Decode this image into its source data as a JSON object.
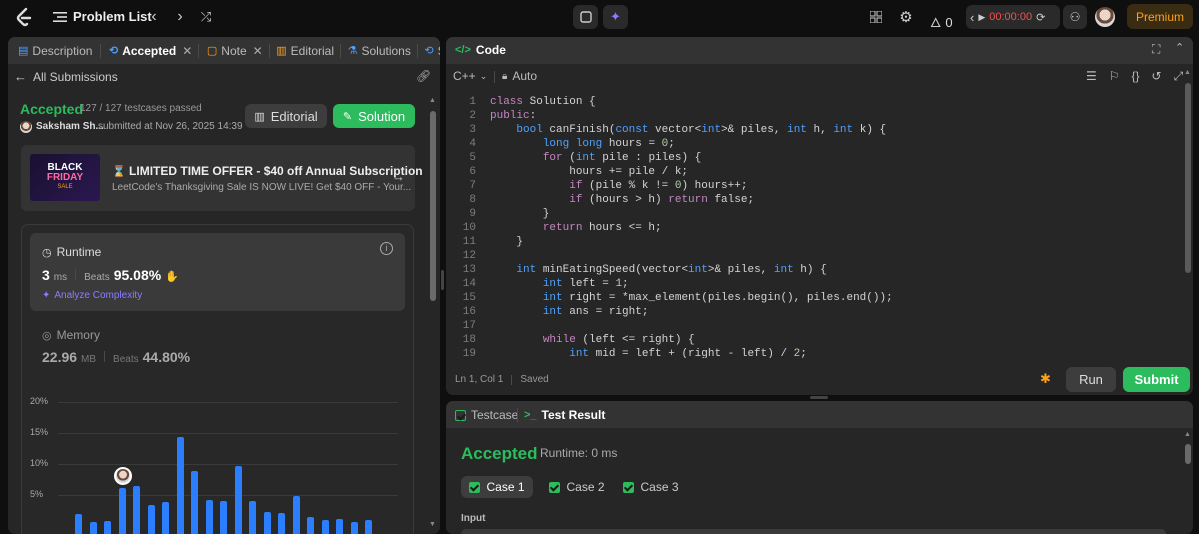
{
  "topbar": {
    "problem_list": "Problem List",
    "streak": "0",
    "timer": "00:00:00",
    "premium": "Premium"
  },
  "left_tabs": [
    "Description",
    "Accepted",
    "Note",
    "Editorial",
    "Solutions",
    "Su"
  ],
  "submission": {
    "back_label": "All Submissions",
    "status": "Accepted",
    "testcases": "127 / 127 testcases passed",
    "user": "Saksham Sh...",
    "submitted": "submitted at Nov 26, 2025 14:39",
    "editorial_btn": "Editorial",
    "solution_btn": "Solution"
  },
  "promo": {
    "banner_line1": "BLACK",
    "banner_line2": "FRIDAY",
    "banner_line3": "SALE",
    "title": "LIMITED TIME OFFER - $40 off Annual Subscription",
    "subtitle": "LeetCode's Thanksgiving Sale IS NOW LIVE! Get $40 OFF - Your..."
  },
  "runtime": {
    "label": "Runtime",
    "value": "3",
    "unit": "ms",
    "beats_label": "Beats",
    "beats_value": "95.08%",
    "analyze": "Analyze Complexity"
  },
  "memory": {
    "label": "Memory",
    "value": "22.96",
    "unit": "MB",
    "beats_label": "Beats",
    "beats_value": "44.80%"
  },
  "chart_data": {
    "type": "bar",
    "y_ticks": [
      "20%",
      "15%",
      "10%",
      "5%"
    ],
    "ylim": [
      0,
      20
    ],
    "values": [
      2.0,
      0.6,
      0.8,
      6.2,
      6.5,
      3.4,
      3.9,
      14.3,
      8.8,
      4.2,
      4.0,
      9.6,
      4.1,
      2.2,
      2.1,
      4.9,
      1.4,
      0.9,
      1.2,
      0.7,
      1.0
    ],
    "highlight_index": 3
  },
  "editor": {
    "title": "Code",
    "language": "C++",
    "auto_label": "Auto",
    "status_pos": "Ln 1, Col 1",
    "status_saved": "Saved",
    "run_btn": "Run",
    "submit_btn": "Submit"
  },
  "code_lines": [
    {
      "n": "1",
      "t": "class Solution {"
    },
    {
      "n": "2",
      "t": "public:"
    },
    {
      "n": "3",
      "t": "    bool canFinish(const vector<int>& piles, int h, int k) {"
    },
    {
      "n": "4",
      "t": "        long long hours = 0;"
    },
    {
      "n": "5",
      "t": "        for (int pile : piles) {"
    },
    {
      "n": "6",
      "t": "            hours += pile / k;"
    },
    {
      "n": "7",
      "t": "            if (pile % k != 0) hours++;"
    },
    {
      "n": "8",
      "t": "            if (hours > h) return false;"
    },
    {
      "n": "9",
      "t": "        }"
    },
    {
      "n": "10",
      "t": "        return hours <= h;"
    },
    {
      "n": "11",
      "t": "    }"
    },
    {
      "n": "12",
      "t": ""
    },
    {
      "n": "13",
      "t": "    int minEatingSpeed(vector<int>& piles, int h) {"
    },
    {
      "n": "14",
      "t": "        int left = 1;"
    },
    {
      "n": "15",
      "t": "        int right = *max_element(piles.begin(), piles.end());"
    },
    {
      "n": "16",
      "t": "        int ans = right;"
    },
    {
      "n": "17",
      "t": ""
    },
    {
      "n": "18",
      "t": "        while (left <= right) {"
    },
    {
      "n": "19",
      "t": "            int mid = left + (right - left) / 2;"
    }
  ],
  "result": {
    "tab_testcase": "Testcase",
    "tab_result": "Test Result",
    "status": "Accepted",
    "runtime": "Runtime: 0 ms",
    "cases": [
      "Case 1",
      "Case 2",
      "Case 3"
    ],
    "input_label": "Input"
  }
}
